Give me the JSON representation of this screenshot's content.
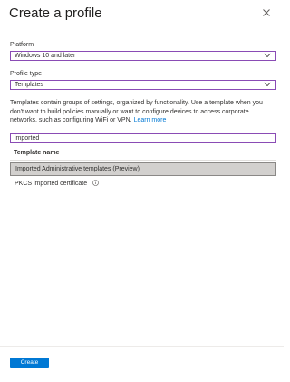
{
  "panel": {
    "title": "Create a profile",
    "close_icon": "close-icon"
  },
  "platform": {
    "label": "Platform",
    "value": "Windows 10 and later"
  },
  "profile_type": {
    "label": "Profile type",
    "value": "Templates"
  },
  "description": {
    "text": "Templates contain groups of settings, organized by functionality. Use a template when you don't want to build policies manually or want to configure devices to access corporate networks, such as configuring WiFi or VPN.",
    "link": "Learn more"
  },
  "search": {
    "value": "imported"
  },
  "table": {
    "header": "Template name",
    "rows": [
      {
        "label": "Imported Administrative templates (Preview)",
        "selected": true
      },
      {
        "label": "PKCS imported certificate",
        "info_icon": "info-icon"
      }
    ]
  },
  "footer": {
    "create_label": "Create"
  },
  "colors": {
    "accent": "#0078d4",
    "focus_border": "#8a4cb5",
    "selected_row": "#d2d0ce"
  }
}
